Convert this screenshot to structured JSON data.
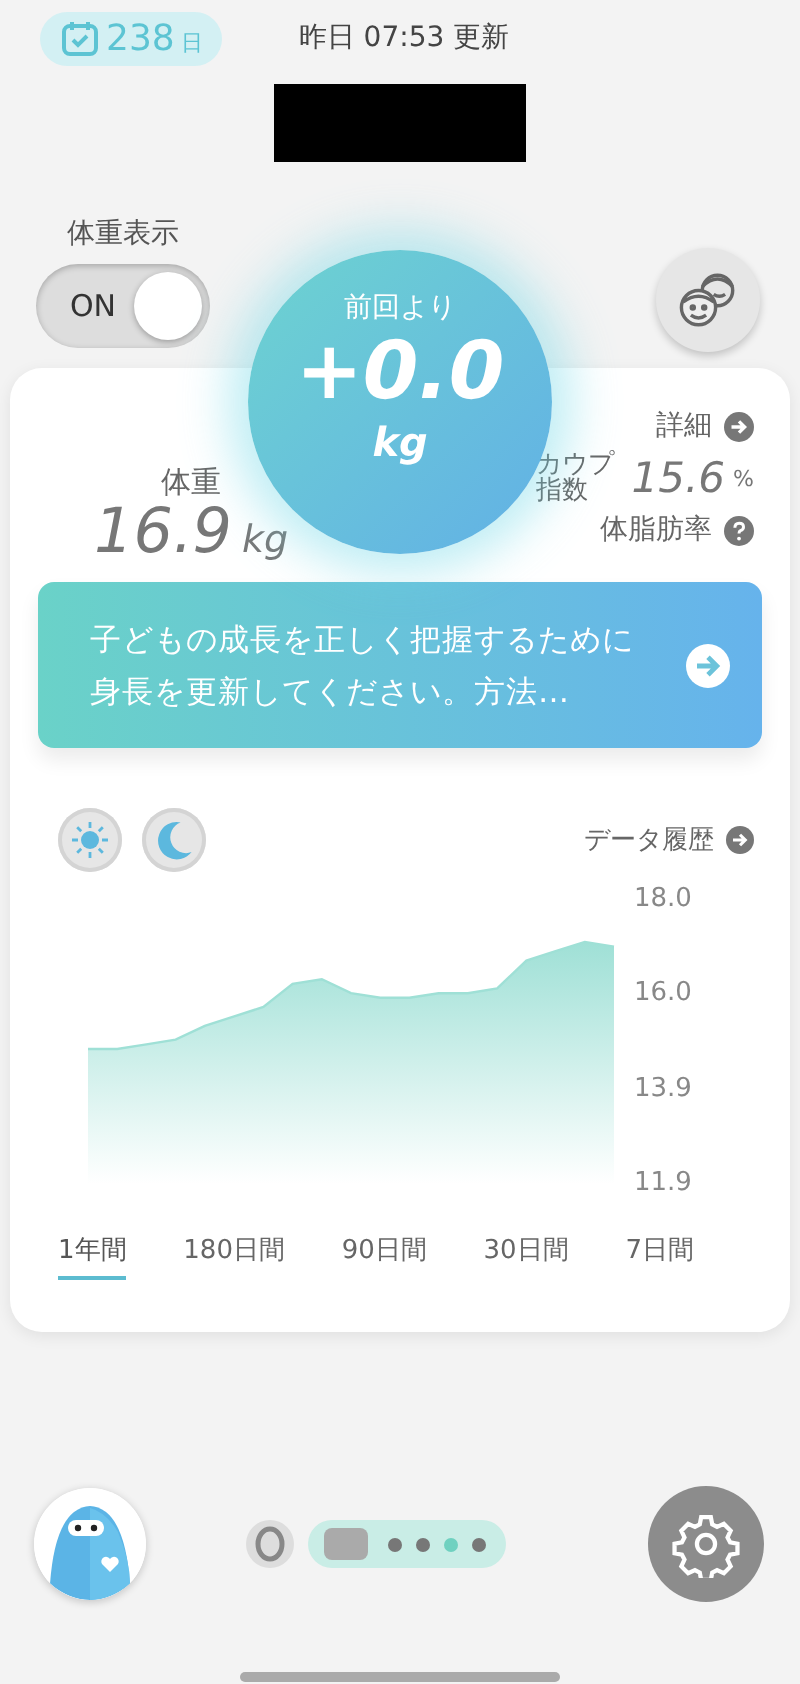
{
  "header": {
    "streak_count": "238",
    "streak_unit": "日",
    "updated": "昨日 07:53 更新"
  },
  "weight_display": {
    "label": "体重表示",
    "value_text": "ON",
    "on": true
  },
  "change": {
    "label": "前回より",
    "value": "+0.0",
    "unit": "kg"
  },
  "weight": {
    "label": "体重",
    "value": "16.9",
    "unit": "kg"
  },
  "detail_link": "詳細",
  "kaup": {
    "label": "カウプ指数",
    "value": "15.6",
    "unit": "%"
  },
  "body_fat_label": "体脂肪率",
  "notice": "子どもの成長を正しく把握するために身長を更新してください。方法…",
  "history_link": "データ履歴",
  "chart_data": {
    "type": "area",
    "ylim": [
      11.9,
      18.0
    ],
    "yticks": [
      {
        "value": 11.9,
        "label": "11.9"
      },
      {
        "value": 13.9,
        "label": "13.9"
      },
      {
        "value": 16.0,
        "label": "16.0"
      },
      {
        "value": 18.0,
        "label": "18.0"
      }
    ],
    "series": [
      {
        "color": "#9fe0d6",
        "values": [
          14.8,
          14.8,
          14.9,
          15.0,
          15.3,
          15.5,
          15.7,
          16.2,
          16.3,
          16.0,
          15.9,
          15.9,
          16.0,
          16.0,
          16.1,
          16.7,
          16.9,
          17.1,
          17.0
        ]
      }
    ]
  },
  "periods": [
    {
      "label": "1年間",
      "selected": true
    },
    {
      "label": "180日間",
      "selected": false
    },
    {
      "label": "90日間",
      "selected": false
    },
    {
      "label": "30日間",
      "selected": false
    },
    {
      "label": "7日間",
      "selected": false
    }
  ],
  "pager": [
    {
      "selected": false
    },
    {
      "selected": false
    },
    {
      "selected": true
    },
    {
      "selected": false
    }
  ]
}
